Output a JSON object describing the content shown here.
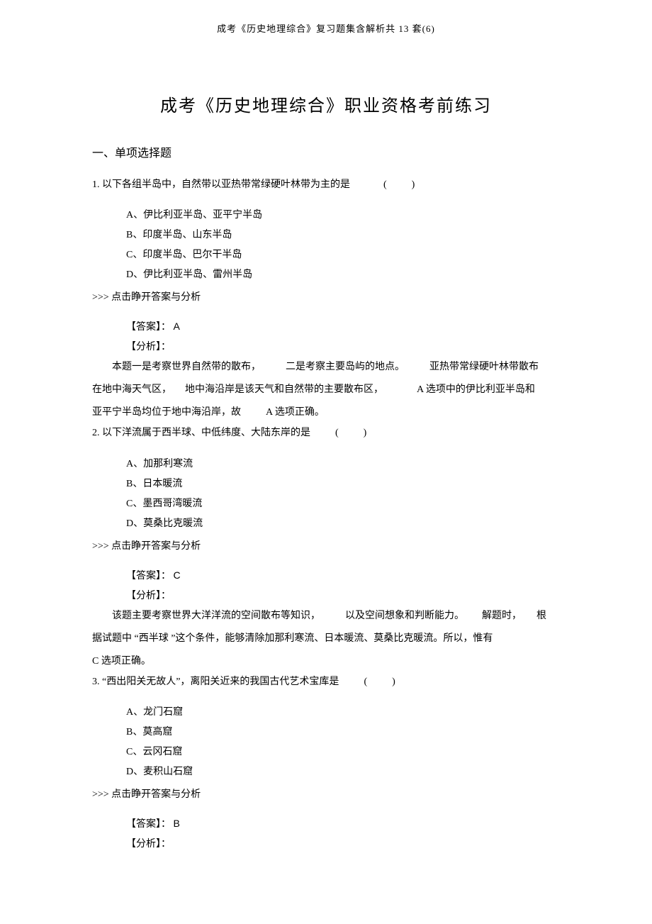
{
  "header": "成考《历史地理综合》复习题集含解析共 13 套(6)",
  "title": "成考《历史地理综合》职业资格考前练习",
  "section": "一、单项选择题",
  "toggle_label": ">>> 点击睁开答案与分析",
  "answer_prefix": "【答案】：",
  "analysis_prefix": "【分析】：",
  "questions": [
    {
      "num": "1.",
      "stem_a": "以下各组半岛中，自然带以亚热带常绿硬叶林带为主的是",
      "stem_b": "(",
      "stem_c": ")",
      "options": {
        "a": "A、伊比利亚半岛、亚平宁半岛",
        "b": "B、印度半岛、山东半岛",
        "c": "C、印度半岛、巴尔干半岛",
        "d": "D、伊比利亚半岛、雷州半岛"
      },
      "answer": "A",
      "analysis_1a": "本题一是考察世界自然带的散布，",
      "analysis_1b": "二是考察主要岛屿的地点。",
      "analysis_1c": "亚热带常绿硬叶林带散布",
      "analysis_2a": "在地中海天气区，",
      "analysis_2b": "地中海沿岸是该天气和自然带的主要散布区，",
      "analysis_2c": "A 选项中的伊比利亚半岛和",
      "analysis_3a": "亚平宁半岛均位于地中海沿岸，故",
      "analysis_3b": "A 选项正确。"
    },
    {
      "num": "2.",
      "stem_a": "以下洋流属于西半球、中低纬度、大陆东岸的是",
      "stem_b": "(",
      "stem_c": ")",
      "options": {
        "a": "A、加那利寒流",
        "b": "B、日本暖流",
        "c": "C、墨西哥湾暖流",
        "d": "D、莫桑比克暖流"
      },
      "answer": "C",
      "analysis_1a": "该题主要考察世界大洋洋流的空间散布等知识，",
      "analysis_1b": "以及空间想象和判断能力。",
      "analysis_1c": "解题时，",
      "analysis_1d": "根",
      "analysis_2": "据试题中 “西半球 ”这个条件，能够清除加那利寒流、日本暖流、莫桑比克暖流。所以，惟有",
      "analysis_3": "C 选项正确。"
    },
    {
      "num": "3.",
      "stem_a": "“西出阳关无故人”，离阳关近来的我国古代艺术宝库是",
      "stem_b": "(",
      "stem_c": ")",
      "options": {
        "a": "A、龙门石窟",
        "b": "B、莫高窟",
        "c": "C、云冈石窟",
        "d": "D、麦积山石窟"
      },
      "answer": "B"
    }
  ]
}
